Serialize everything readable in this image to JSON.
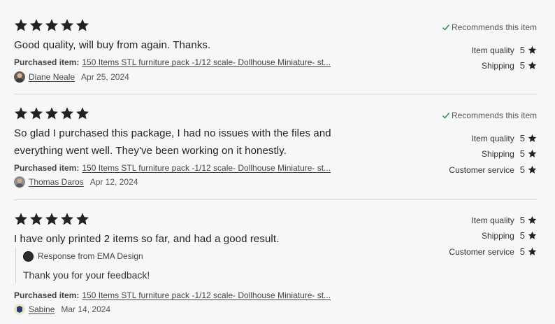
{
  "colors": {
    "star": "#222222",
    "check": "#2a8a3e",
    "divider": "#d6d6d6"
  },
  "icons": {
    "star": "star-icon",
    "check": "check-icon",
    "shop": "shop-logo-icon"
  },
  "reviews": [
    {
      "rating": 5,
      "text": "Good quality, will buy from again. Thanks.",
      "purchased_label": "Purchased item:",
      "purchased_item": "150 Items STL furniture pack -1/12 scale- Dollhouse Miniature- st...",
      "reviewer": "Diane Neale",
      "date": "Apr 25, 2024",
      "recommends": "Recommends this item",
      "ratings": [
        {
          "label": "Item quality",
          "value": "5"
        },
        {
          "label": "Shipping",
          "value": "5"
        }
      ]
    },
    {
      "rating": 5,
      "text": "So glad I purchased this package, I had no issues with the files and everything went well. They've been working on it honestly.",
      "purchased_label": "Purchased item:",
      "purchased_item": "150 Items STL furniture pack -1/12 scale- Dollhouse Miniature- st...",
      "reviewer": "Thomas Daros",
      "date": "Apr 12, 2024",
      "recommends": "Recommends this item",
      "ratings": [
        {
          "label": "Item quality",
          "value": "5"
        },
        {
          "label": "Shipping",
          "value": "5"
        },
        {
          "label": "Customer service",
          "value": "5"
        }
      ]
    },
    {
      "rating": 5,
      "text": "I have only printed 2 items so far, and had a good result.",
      "response_title": "Response from EMA Design",
      "response_text": "Thank you for your feedback!",
      "purchased_label": "Purchased item:",
      "purchased_item": "150 Items STL furniture pack -1/12 scale- Dollhouse Miniature- st...",
      "reviewer": "Sabine",
      "date": "Mar 14, 2024",
      "ratings": [
        {
          "label": "Item quality",
          "value": "5"
        },
        {
          "label": "Shipping",
          "value": "5"
        },
        {
          "label": "Customer service",
          "value": "5"
        }
      ]
    }
  ]
}
